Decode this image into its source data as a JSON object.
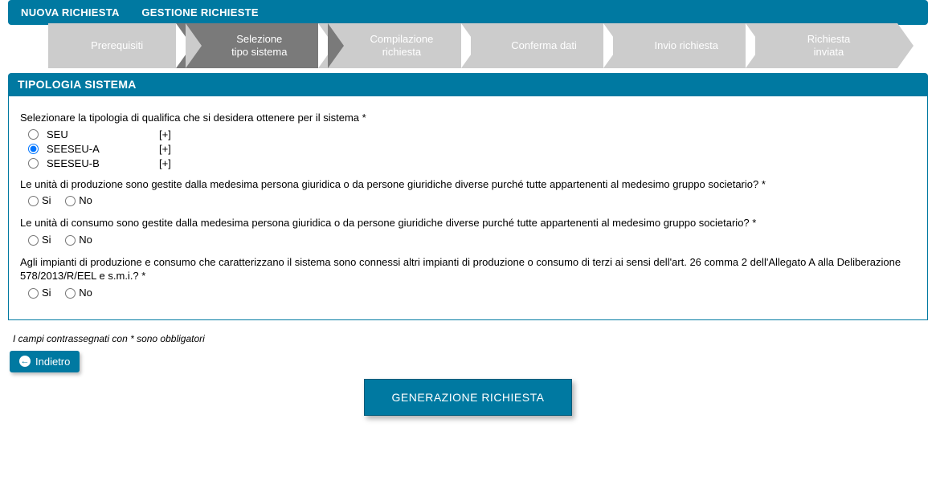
{
  "nav": {
    "item1": "NUOVA RICHIESTA",
    "item2": "GESTIONE RICHIESTE"
  },
  "steps": [
    {
      "label": "Prerequisiti",
      "active": false
    },
    {
      "label": "Selezione\ntipo sistema",
      "active": true
    },
    {
      "label": "Compilazione\nrichiesta",
      "active": false
    },
    {
      "label": "Conferma dati",
      "active": false
    },
    {
      "label": "Invio richiesta",
      "active": false
    },
    {
      "label": "Richiesta\ninviata",
      "active": false
    }
  ],
  "section_title": "TIPOLOGIA SISTEMA",
  "q1": "Selezionare la tipologia di qualifica che si desidera ottenere per il sistema *",
  "q1_options": [
    {
      "label": "SEU",
      "plus": "[+]",
      "selected": false
    },
    {
      "label": "SEESEU-A",
      "plus": "[+]",
      "selected": true
    },
    {
      "label": "SEESEU-B",
      "plus": "[+]",
      "selected": false
    }
  ],
  "q2": "Le unità di produzione sono gestite dalla medesima persona giuridica o da persone giuridiche diverse purché tutte appartenenti al medesimo gruppo societario? *",
  "q3": "Le unità di consumo sono gestite dalla medesima persona giuridica o da persone giuridiche diverse purché tutte appartenenti al medesimo gruppo societario? *",
  "q4": "Agli impianti di produzione e consumo che caratterizzano il sistema sono connessi altri impianti di produzione o consumo di terzi ai sensi dell'art. 26 comma 2 dell'Allegato A alla Deliberazione 578/2013/R/EEL e s.m.i.? *",
  "yn": {
    "si": "Si",
    "no": "No"
  },
  "footer_note": "I campi contrassegnati con * sono obbligatori",
  "back_label": "Indietro",
  "main_button": "GENERAZIONE RICHIESTA"
}
